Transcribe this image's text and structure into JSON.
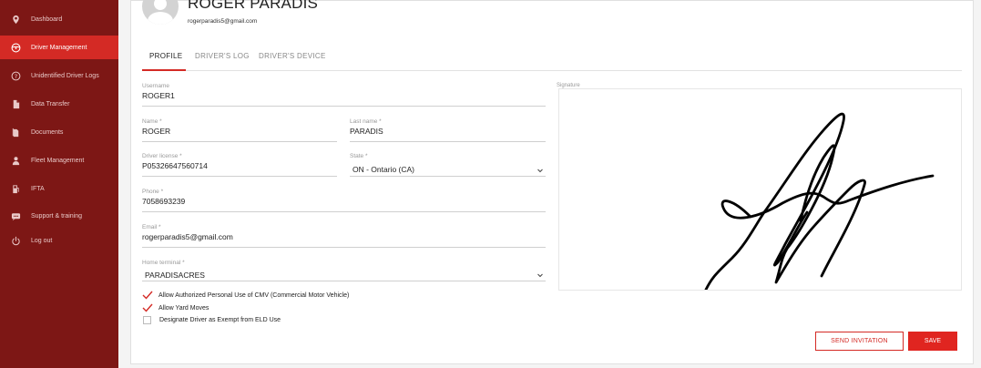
{
  "sidebar": {
    "items": [
      {
        "label": "Dashboard",
        "icon": "location-pin-icon"
      },
      {
        "label": "Driver Management",
        "icon": "steering-wheel-icon",
        "active": true
      },
      {
        "label": "Unidentified Driver Logs",
        "icon": "question-circle-icon"
      },
      {
        "label": "Data Transfer",
        "icon": "file-icon"
      },
      {
        "label": "Documents",
        "icon": "documents-icon"
      },
      {
        "label": "Fleet Management",
        "icon": "person-icon"
      },
      {
        "label": "IFTA",
        "icon": "fuel-pump-icon"
      },
      {
        "label": "Support & training",
        "icon": "chat-icon"
      },
      {
        "label": "Log out",
        "icon": "power-icon"
      }
    ]
  },
  "driver": {
    "name": "ROGER PARADIS",
    "email": "rogerparadis5@gmail.com"
  },
  "tabs": [
    "PROFILE",
    "DRIVER'S LOG",
    "DRIVER'S DEVICE"
  ],
  "form": {
    "username": {
      "label": "Username",
      "value": "ROGER1"
    },
    "name": {
      "label": "Name *",
      "value": "ROGER"
    },
    "last_name": {
      "label": "Last name *",
      "value": "PARADIS"
    },
    "license": {
      "label": "Driver license *",
      "value": "P05326647560714"
    },
    "state": {
      "label": "State *",
      "value": "ON - Ontario (CA)"
    },
    "phone": {
      "label": "Phone *",
      "value": "7058693239"
    },
    "email": {
      "label": "Email *",
      "value": "rogerparadis5@gmail.com"
    },
    "home_terminal": {
      "label": "Home terminal *",
      "value": "PARADISACRES"
    },
    "signature_label": "Signature"
  },
  "checkboxes": [
    {
      "label": "Allow Authorized Personal Use of CMV (Commercial Motor Vehicle)",
      "checked": true
    },
    {
      "label": "Allow Yard Moves",
      "checked": true
    },
    {
      "label": "Designate Driver as Exempt from ELD Use",
      "checked": false
    }
  ],
  "buttons": {
    "send_invitation": "SEND INVITATION",
    "save": "SAVE"
  },
  "colors": {
    "sidebar": "#7d1715",
    "accent": "#d42a25"
  }
}
